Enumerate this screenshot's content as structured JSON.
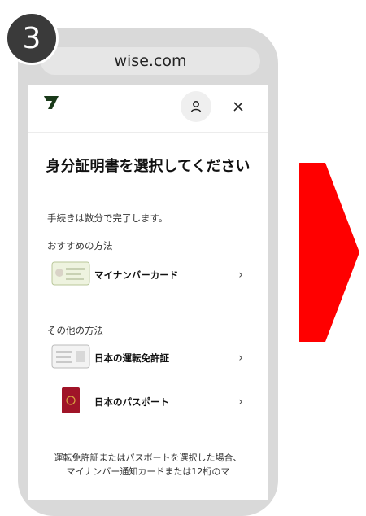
{
  "step_number": "3",
  "browser": {
    "url": "wise.com"
  },
  "header": {
    "logo_icon": "wise-logo-icon",
    "account_icon": "user-icon",
    "close_icon": "close-icon"
  },
  "page": {
    "title": "身分証明書を選択してください",
    "subtitle": "手続きは数分で完了します。",
    "recommended_heading": "おすすめの方法",
    "recommended_options": [
      {
        "label": "マイナンバーカード",
        "icon": "my-number-card-icon"
      }
    ],
    "other_heading": "その他の方法",
    "other_options": [
      {
        "label": "日本の運転免許証",
        "icon": "drivers-license-icon"
      },
      {
        "label": "日本のパスポート",
        "icon": "passport-icon"
      }
    ],
    "note": "運転免許証またはパスポートを選択した場合、マイナンバー通知カードまたは12桁のマ"
  },
  "colors": {
    "arrow": "#ff0000",
    "logo": "#1a3a1a",
    "step_badge": "#3a3a3a"
  }
}
